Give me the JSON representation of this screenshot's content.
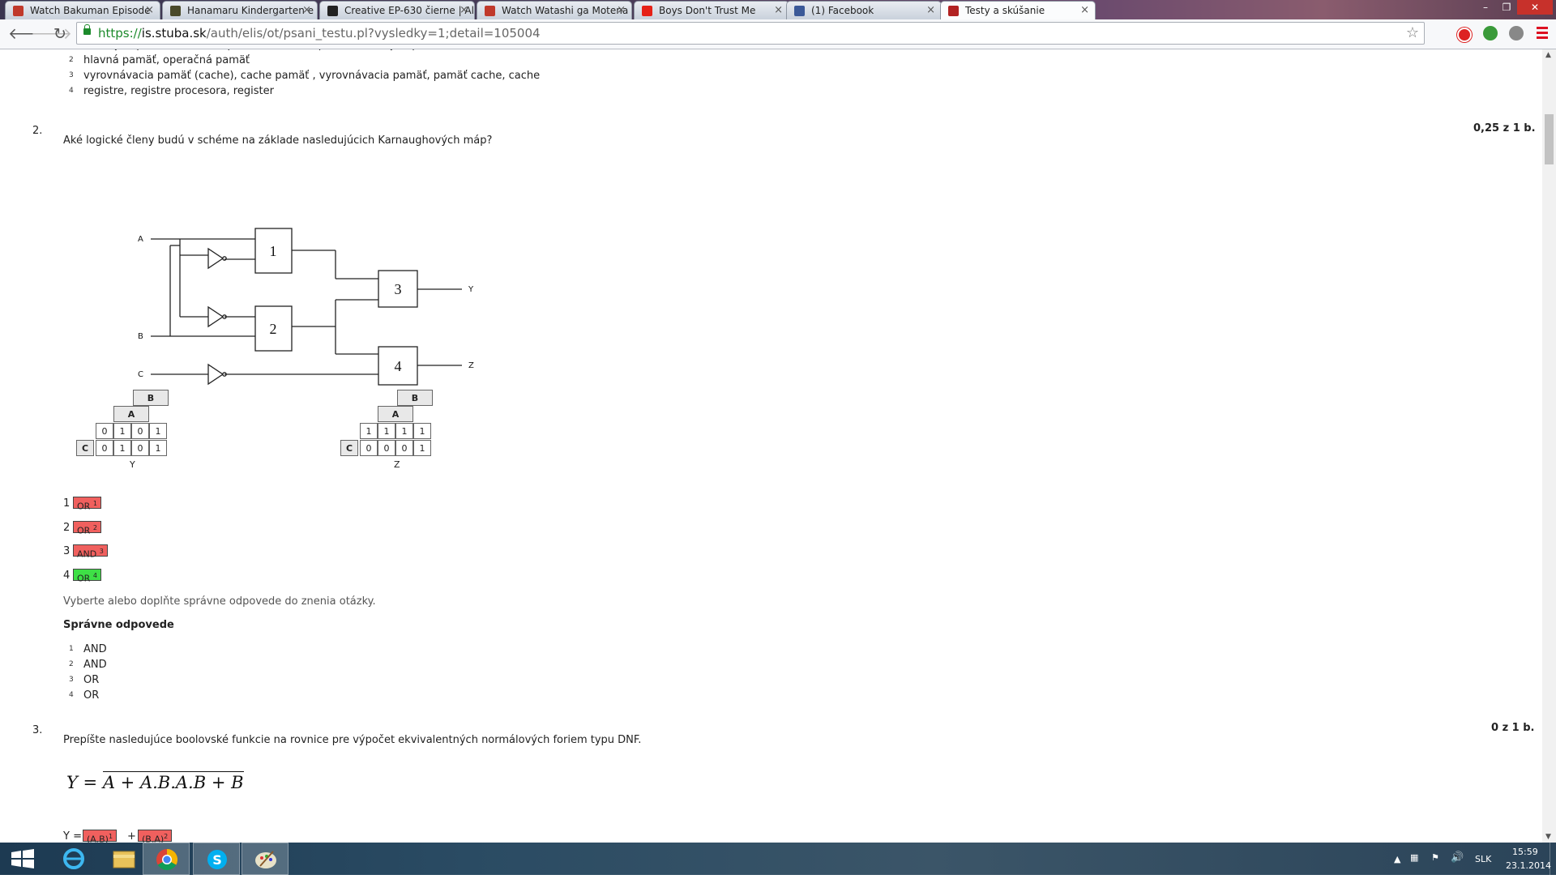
{
  "browser": {
    "tabs": [
      {
        "title": "Watch Bakuman Episode",
        "icon": "kissanime-icon",
        "color": "#c0392b"
      },
      {
        "title": "Hanamaru Kindergarten e",
        "icon": "anime-site-icon",
        "color": "#4a4a2a"
      },
      {
        "title": "Creative EP-630 čierne | Al:",
        "icon": "alza-icon",
        "color": "#222222"
      },
      {
        "title": "Watch Watashi ga Motena",
        "icon": "kissanime-icon",
        "color": "#c0392b"
      },
      {
        "title": "Boys Don't Trust Me",
        "icon": "youtube-icon",
        "color": "#e62117"
      },
      {
        "title": "(1) Facebook",
        "icon": "facebook-icon",
        "color": "#3b5998"
      },
      {
        "title": "Testy a skúšanie",
        "icon": "ais-icon",
        "color": "#b22222",
        "active": true
      }
    ],
    "url_scheme": "https://",
    "url_host": "is.stuba.sk",
    "url_path": "/auth/elis/ot/psani_testu.pl?vysledky=1;detail=105004"
  },
  "prev_answers": [
    {
      "n": "1",
      "text": "vonkajšie pamäte, externé pamäte, externá pamäť, vonkajšia pamäť"
    },
    {
      "n": "2",
      "text": "hlavná pamäť, operačná pamäť"
    },
    {
      "n": "3",
      "text": "vyrovnávacia pamäť (cache), cache pamäť , vyrovnávacia pamäť, pamäť cache, cache"
    },
    {
      "n": "4",
      "text": "registre, registre procesora, register"
    }
  ],
  "q2": {
    "number": "2.",
    "score": "0,25 z 1 b.",
    "question": "Aké logické členy budú v schéme na základe nasledujúcich Karnaughových máp?",
    "circuit": {
      "inputs": [
        "A",
        "B",
        "C"
      ],
      "gates": [
        "1",
        "2",
        "3",
        "4"
      ],
      "outputs": [
        "Y",
        "Z"
      ]
    },
    "kmap_y": {
      "B": "B",
      "A": "A",
      "C": "C",
      "row1": [
        "0",
        "1",
        "0",
        "1"
      ],
      "row2": [
        "0",
        "1",
        "0",
        "1"
      ],
      "label": "Y"
    },
    "kmap_z": {
      "B": "B",
      "A": "A",
      "C": "C",
      "row1": [
        "1",
        "1",
        "1",
        "1"
      ],
      "row2": [
        "0",
        "0",
        "0",
        "1"
      ],
      "label": "Z"
    },
    "user_answers": [
      {
        "n": "1",
        "value": "OR",
        "sup": "1",
        "status": "wrong"
      },
      {
        "n": "2",
        "value": "OR",
        "sup": "2",
        "status": "wrong"
      },
      {
        "n": "3",
        "value": "AND",
        "sup": "3",
        "status": "wrong"
      },
      {
        "n": "4",
        "value": "OR",
        "sup": "4",
        "status": "correct"
      }
    ],
    "instruction": "Vyberte alebo doplňte správne odpovede do znenia otázky.",
    "correct_heading": "Správne odpovede",
    "correct_answers": [
      {
        "n": "1",
        "text": "AND"
      },
      {
        "n": "2",
        "text": "AND"
      },
      {
        "n": "3",
        "text": "OR"
      },
      {
        "n": "4",
        "text": "OR"
      }
    ]
  },
  "q3": {
    "number": "3.",
    "score": "0 z 1 b.",
    "question": "Prepíšte nasledujúce boolovské funkcie na rovnice pre výpočet ekvivalentných normálových foriem typu DNF.",
    "formula_lhs": "Y =",
    "formula_rhs": "A + A.B.A.B + B",
    "answer_prefix": "Y =",
    "answer_parts": [
      {
        "value": "(A.B)",
        "sup": "1"
      },
      {
        "value": "(B.A)",
        "sup": "2"
      }
    ],
    "answer_sep": "+"
  },
  "taskbar": {
    "apps": [
      "start-button",
      "internet-explorer-icon",
      "file-explorer-icon",
      "chrome-icon",
      "skype-icon",
      "paint-icon"
    ],
    "lang": "SLK",
    "time": "15:59",
    "date": "23.1.2014"
  }
}
